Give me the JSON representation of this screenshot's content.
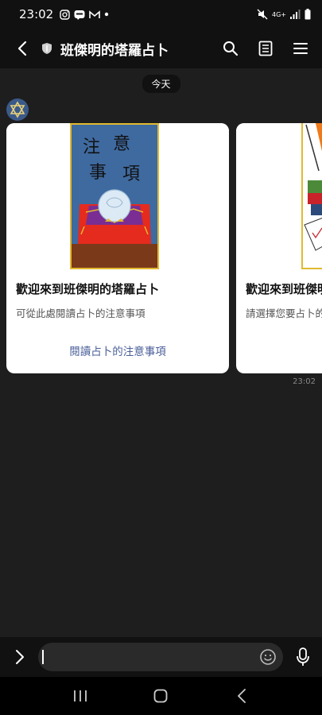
{
  "status": {
    "time": "23:02",
    "network_label": "4G+",
    "left_icons": [
      "instagram-icon",
      "line-icon",
      "gmail-icon",
      "dot-icon"
    ],
    "right_icons": [
      "mute-icon",
      "signal-icon",
      "battery-icon"
    ]
  },
  "header": {
    "title": "班傑明的塔羅占卜",
    "actions": [
      "search-icon",
      "notes-icon",
      "menu-icon"
    ]
  },
  "chat": {
    "date_label": "今天",
    "time": "23:02",
    "cards": [
      {
        "title": "歡迎來到班傑明的塔羅占卜",
        "description": "可從此處閱讀占卜的注意事項",
        "action": "閱讀占卜的注意事項",
        "image_text": [
          "注",
          "意",
          "事",
          "項"
        ]
      },
      {
        "title": "歡迎來到班傑明的塔羅占卜",
        "description": "請選擇您要占卜的",
        "action": ""
      }
    ]
  },
  "input": {
    "placeholder": ""
  },
  "nav": {
    "buttons": [
      "recent-apps-icon",
      "home-icon",
      "back-icon"
    ]
  },
  "colors": {
    "background": "#1e1e1e",
    "bars": "#111111",
    "card": "#ffffff",
    "action_link": "#4a5f9a"
  }
}
